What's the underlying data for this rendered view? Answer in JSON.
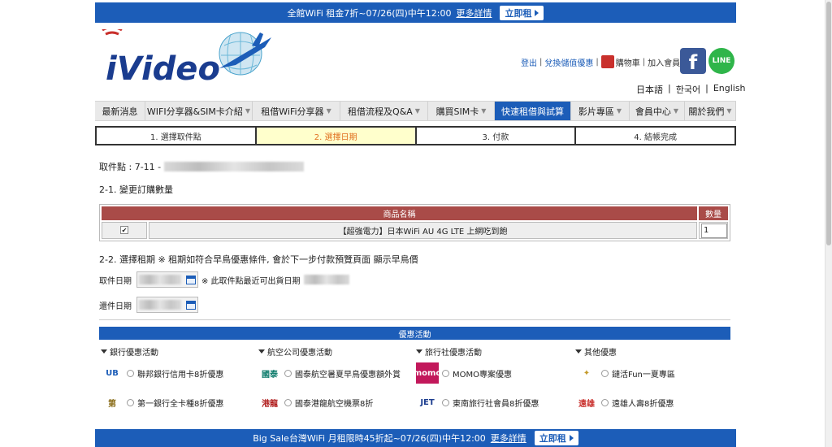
{
  "top_banner": {
    "text": "全館WiFi 租金7折~07/26(四)中午12:00",
    "more": "更多詳情",
    "button": "立即租"
  },
  "header": {
    "logo_text": "iVideo",
    "links": [
      "登出",
      "兌換儲值優惠",
      "購物車",
      "加入會員"
    ],
    "facebook": "f",
    "line": "LINE",
    "languages": [
      "日本語",
      "한국어",
      "English"
    ]
  },
  "nav": {
    "items": [
      {
        "label": "最新消息",
        "caret": false
      },
      {
        "label": "WIFI分享器&SIM卡介紹",
        "caret": true
      },
      {
        "label": "租借WiFi分享器",
        "caret": true
      },
      {
        "label": "租借流程及Q&A",
        "caret": true
      },
      {
        "label": "購買SIM卡",
        "caret": true
      },
      {
        "label": "快速租借與試算",
        "caret": false
      },
      {
        "label": "影片專區",
        "caret": true
      },
      {
        "label": "會員中心",
        "caret": true
      },
      {
        "label": "關於我們",
        "caret": true
      }
    ],
    "active_index": 5
  },
  "steps": [
    "1. 選擇取件點",
    "2. 選擇日期",
    "3. 付款",
    "4. 結帳完成"
  ],
  "active_step": 1,
  "pickup": {
    "label": "取件點 : 7-11 -"
  },
  "section1": {
    "title": "2-1. 變更訂購數量",
    "table": {
      "headers": [
        "商品名稱",
        "數量"
      ],
      "row": {
        "checked": "✔",
        "product": "【超強電力】日本WiFi AU 4G LTE 上網吃到飽",
        "qty": "1"
      }
    }
  },
  "section2": {
    "title": "2-2. 選擇租期 ※ 租期如符合早鳥優惠條件, 會於下一步付款預覽頁面 顯示早鳥價",
    "pickup_date_label": "取件日期",
    "pickup_note": "※ 此取件點最近可出貨日期",
    "return_date_label": "還件日期"
  },
  "promo": {
    "title": "優惠活動",
    "columns": [
      {
        "title": "銀行優惠活動",
        "items": [
          "聯邦銀行信用卡8折優惠",
          "第一銀行全卡種8折優惠"
        ],
        "logos": [
          "UB",
          "第"
        ]
      },
      {
        "title": "航空公司優惠活動",
        "items": [
          "國泰航空暑夏早鳥優惠額外賞",
          "國泰港龍航空機票8折"
        ],
        "logos": [
          "國泰",
          "港龍"
        ]
      },
      {
        "title": "旅行社優惠活動",
        "items": [
          "MOMO專案優惠",
          "東南旅行社會員8折優惠"
        ],
        "logos": [
          "momo",
          "JET"
        ]
      },
      {
        "title": "其他優惠",
        "items": [
          "鏈活Fun一夏專區",
          "遠雄人壽8折優惠"
        ],
        "logos": [
          "✦",
          "遠雄"
        ]
      }
    ]
  },
  "bottom_banner": {
    "text": "Big Sale台灣WiFi 月租限時45折起~07/26(四)中午12:00",
    "more": "更多詳情",
    "button": "立即租"
  },
  "colors": {
    "brand_blue": "#1c5db8",
    "table_header": "#a94b48",
    "active_step_bg": "#ffffcc"
  }
}
